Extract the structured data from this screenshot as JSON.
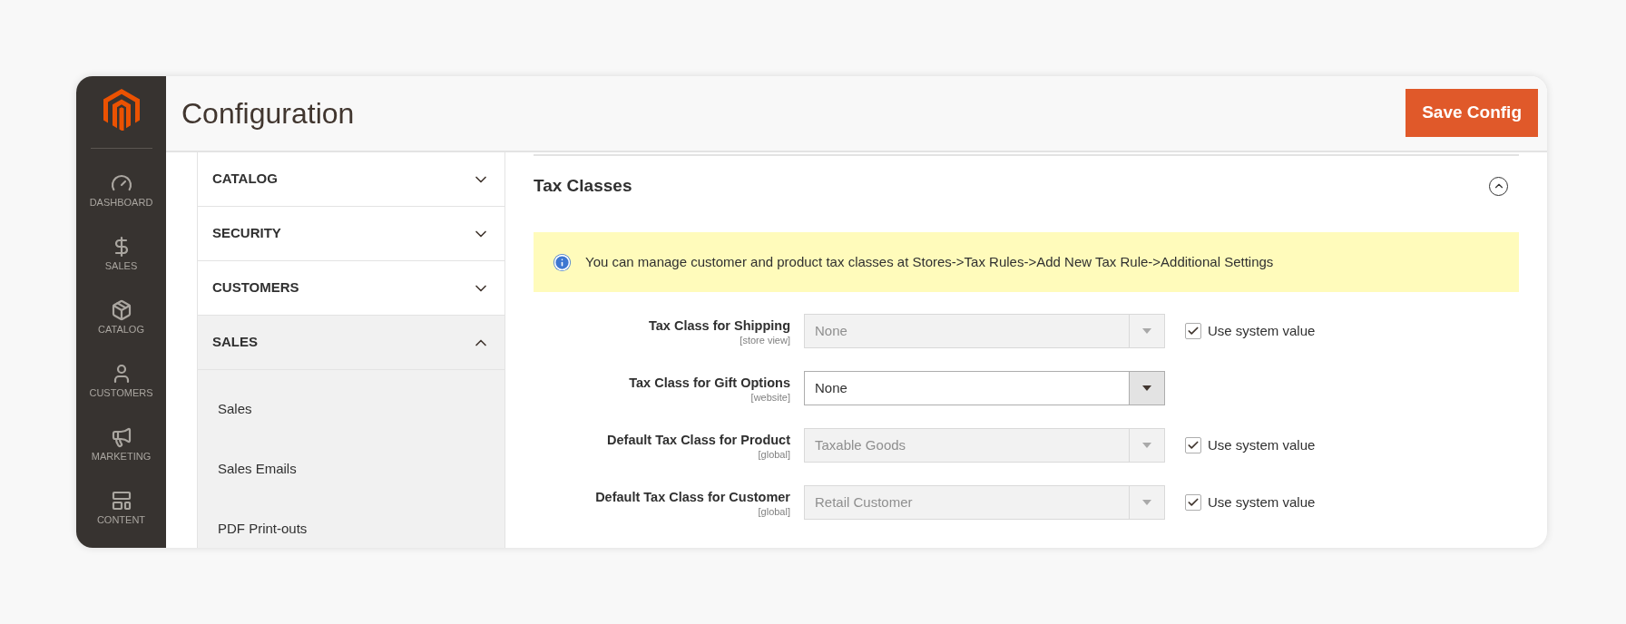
{
  "menu": [
    {
      "label": "DASHBOARD"
    },
    {
      "label": "SALES"
    },
    {
      "label": "CATALOG"
    },
    {
      "label": "CUSTOMERS"
    },
    {
      "label": "MARKETING"
    },
    {
      "label": "CONTENT"
    }
  ],
  "page_title": "Configuration",
  "save_button": "Save Config",
  "config_nav": [
    {
      "label": "CATALOG",
      "expanded": false
    },
    {
      "label": "SECURITY",
      "expanded": false
    },
    {
      "label": "CUSTOMERS",
      "expanded": false
    },
    {
      "label": "SALES",
      "expanded": true,
      "children": [
        {
          "label": "Sales"
        },
        {
          "label": "Sales Emails"
        },
        {
          "label": "PDF Print-outs"
        }
      ]
    }
  ],
  "section": {
    "title": "Tax Classes",
    "expanded": true,
    "notice": "You can manage customer and product tax classes at Stores->Tax Rules->Add New Tax Rule->Additional Settings",
    "fields": [
      {
        "label": "Tax Class for Shipping",
        "scope": "[store view]",
        "value": "None",
        "disabled": true,
        "use_system_value": {
          "label": "Use system value",
          "checked": true
        }
      },
      {
        "label": "Tax Class for Gift Options",
        "scope": "[website]",
        "value": "None",
        "disabled": false
      },
      {
        "label": "Default Tax Class for Product",
        "scope": "[global]",
        "value": "Taxable Goods",
        "disabled": true,
        "use_system_value": {
          "label": "Use system value",
          "checked": true
        }
      },
      {
        "label": "Default Tax Class for Customer",
        "scope": "[global]",
        "value": "Retail Customer",
        "disabled": true,
        "use_system_value": {
          "label": "Use system value",
          "checked": true
        }
      }
    ]
  }
}
